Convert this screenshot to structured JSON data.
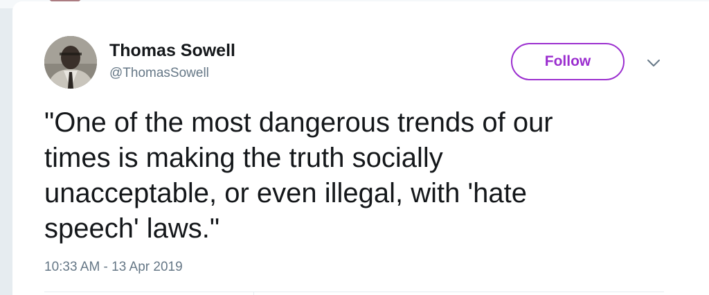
{
  "tweet": {
    "author_name": "Thomas Sowell",
    "author_handle": "@ThomasSowell",
    "follow_label": "Follow",
    "text": "\"One of the most dangerous trends of our\ntimes is making the truth socially\nunacceptable, or even illegal, with 'hate\nspeech' laws.\"",
    "timestamp": "10:33 AM - 13 Apr 2019"
  },
  "icons": {
    "menu_caret": "chevron-down-icon",
    "avatar": "avatar-photo"
  },
  "colors": {
    "accent": "#9b2ecf",
    "text_primary": "#14171a",
    "text_secondary": "#657786",
    "background": "#e6ecf0",
    "card": "#ffffff"
  }
}
